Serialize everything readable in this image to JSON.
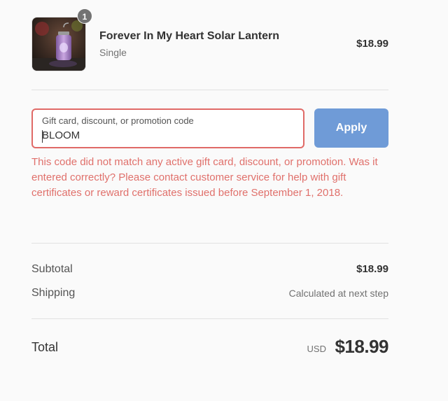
{
  "cart": {
    "items": [
      {
        "name": "Forever In My Heart Solar Lantern",
        "variant": "Single",
        "price": "$18.99",
        "quantity": "1",
        "thumbnail_icon": "solar-lantern-product-image"
      }
    ]
  },
  "discount": {
    "label": "Gift card, discount, or promotion code",
    "value": "BLOOM",
    "apply_label": "Apply",
    "error": "This code did not match any active gift card, discount, or promotion. Was it entered correctly? Please contact customer service for help with gift certificates or reward certificates issued before September 1, 2018."
  },
  "totals": {
    "subtotal_label": "Subtotal",
    "subtotal_value": "$18.99",
    "shipping_label": "Shipping",
    "shipping_value": "Calculated at next step",
    "total_label": "Total",
    "currency": "USD",
    "total_value": "$18.99"
  },
  "colors": {
    "error": "#e0706b",
    "apply_button": "#6f9bd7",
    "background": "#fafafa"
  }
}
